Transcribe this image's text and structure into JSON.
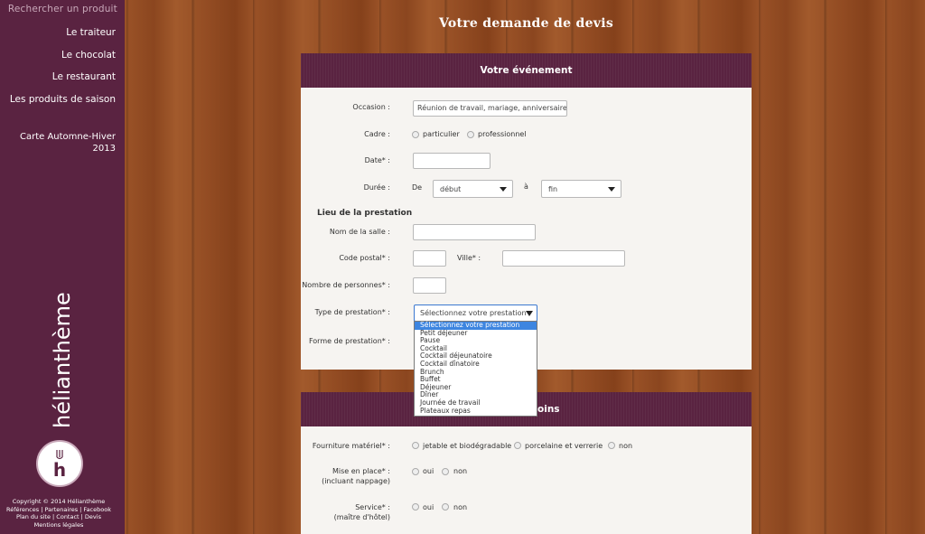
{
  "sidebar": {
    "search": "Rechercher un produit",
    "nav": [
      "Le traiteur",
      "Le chocolat",
      "Le restaurant",
      "Les produits de saison"
    ],
    "season_line1": "Carte Automne-Hiver",
    "season_line2": "2013",
    "brand": "hélianthème",
    "logo_letter": "h",
    "footer": {
      "copyright": "Copyright © 2014 Hélianthème",
      "links1": "Références | Partenaires | Facebook",
      "links2": "Plan du site | Contact | Devis",
      "links3": "Mentions légales"
    }
  },
  "page": {
    "title": "Votre demande de devis"
  },
  "panel1": {
    "header": "Votre événement",
    "occasion_label": "Occasion :",
    "occasion_placeholder": "Réunion de travail, mariage, anniversaire...",
    "cadre_label": "Cadre :",
    "cadre_options": [
      "particulier",
      "professionnel"
    ],
    "date_label": "Date* :",
    "duree_label": "Durée :",
    "de": "De",
    "a": "à",
    "debut": "début",
    "fin": "fin",
    "lieu_title": "Lieu de la prestation",
    "salle_label": "Nom de la salle :",
    "code_label": "Code postal* :",
    "ville_label": "Ville* :",
    "personnes_label": "Nombre de personnes* :",
    "type_label": "Type de prestation* :",
    "forme_label": "Forme de prestation* :",
    "type_selected": "Sélectionnez votre prestation",
    "type_options": [
      "Sélectionnez votre prestation",
      "Petit déjeuner",
      "Pause",
      "Cocktail",
      "Cocktail déjeunatoire",
      "Cocktail dînatoire",
      "Brunch",
      "Buffet",
      "Déjeuner",
      "Dîner",
      "Journée de travail",
      "Plateaux repas"
    ]
  },
  "panel2": {
    "header_suffix": "oins",
    "fourniture_label": "Fourniture matériel* :",
    "fourniture_options": [
      "jetable et biodégradable",
      "porcelaine et verrerie",
      "non"
    ],
    "mise_label": "Mise en place* :",
    "mise_sub": "(incluant nappage)",
    "service_label": "Service* :",
    "service_sub": "(maître d'hôtel)",
    "oui": "oui",
    "non": "non"
  },
  "colors": {
    "sidebar": "#5a2341",
    "accent_blue": "#3d85e0"
  }
}
